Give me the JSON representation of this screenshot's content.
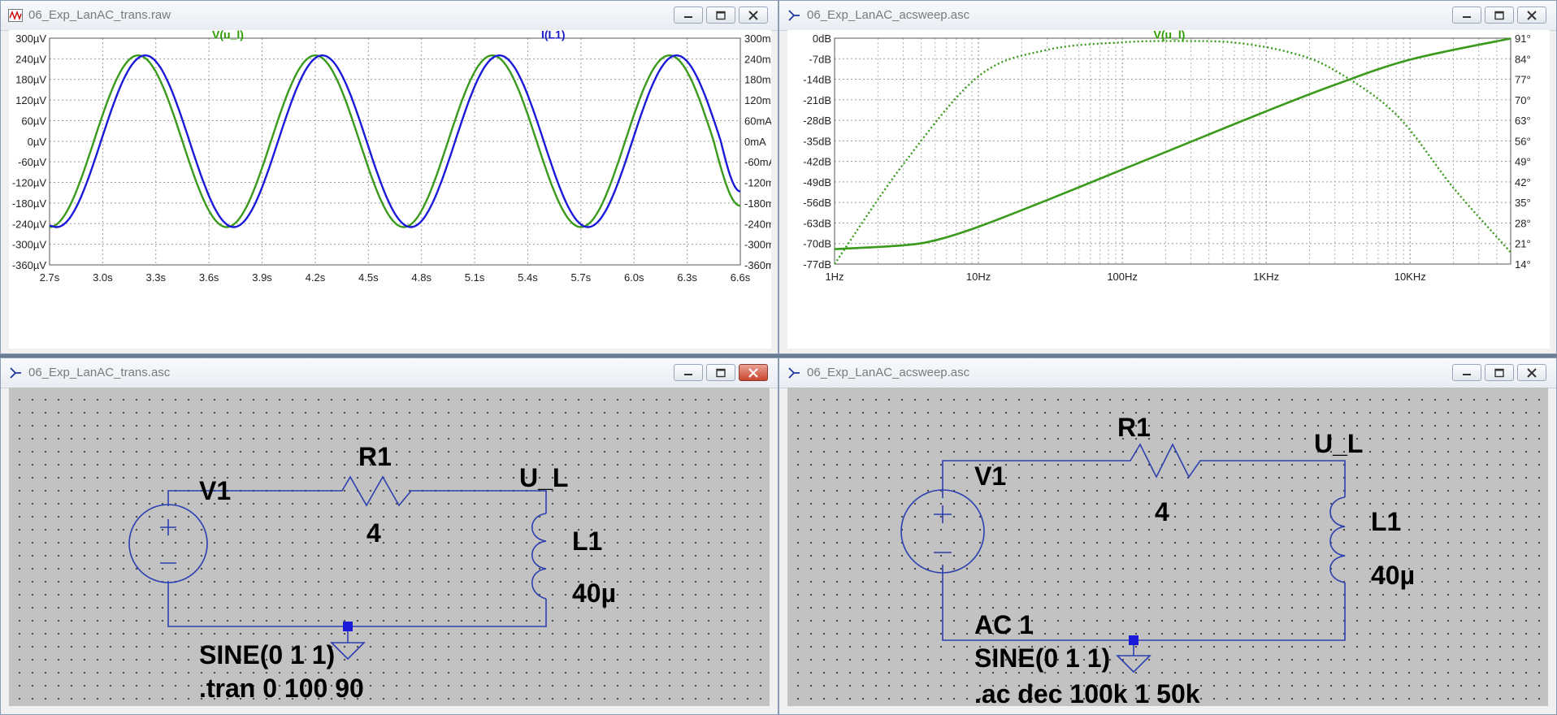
{
  "windows": {
    "trans_plot": {
      "title": "06_Exp_LanAC_trans.raw",
      "trace_left": "V(u_l)",
      "trace_right": "I(L1)",
      "y_left_ticks": [
        "300µV",
        "240µV",
        "180µV",
        "120µV",
        "60µV",
        "0µV",
        "-60µV",
        "-120µV",
        "-180µV",
        "-240µV",
        "-300µV",
        "-360µV"
      ],
      "y_right_ticks": [
        "300mA",
        "240mA",
        "180mA",
        "120mA",
        "60mA",
        "0mA",
        "-60mA",
        "-120mA",
        "-180mA",
        "-240mA",
        "-300mA",
        "-360mA"
      ],
      "x_ticks": [
        "2.7s",
        "3.0s",
        "3.3s",
        "3.6s",
        "3.9s",
        "4.2s",
        "4.5s",
        "4.8s",
        "5.1s",
        "5.4s",
        "5.7s",
        "6.0s",
        "6.3s",
        "6.6s"
      ]
    },
    "ac_plot": {
      "title": "06_Exp_LanAC_acsweep.asc",
      "trace": "V(u_l)",
      "y_left_ticks": [
        "0dB",
        "-7dB",
        "-14dB",
        "-21dB",
        "-28dB",
        "-35dB",
        "-42dB",
        "-49dB",
        "-56dB",
        "-63dB",
        "-70dB",
        "-77dB"
      ],
      "y_right_ticks": [
        "91°",
        "84°",
        "77°",
        "70°",
        "63°",
        "56°",
        "49°",
        "42°",
        "35°",
        "28°",
        "21°",
        "14°"
      ],
      "x_ticks": [
        "1Hz",
        "10Hz",
        "100Hz",
        "1KHz",
        "10KHz"
      ]
    },
    "trans_schem": {
      "title": "06_Exp_LanAC_trans.asc",
      "v_label": "V1",
      "r_label": "R1",
      "r_value": "4",
      "node_label": "U_L",
      "l_label": "L1",
      "l_value": "40µ",
      "source_value": "SINE(0 1 1)",
      "directive": ".tran 0 100 90"
    },
    "ac_schem": {
      "title": "06_Exp_LanAC_acsweep.asc",
      "v_label": "V1",
      "r_label": "R1",
      "r_value": "4",
      "node_label": "U_L",
      "l_label": "L1",
      "l_value": "40µ",
      "source_ac": "AC 1",
      "source_value": "SINE(0 1 1)",
      "directive": ".ac dec 100k 1 50k"
    }
  },
  "colors": {
    "green_trace": "#3a9a1c",
    "blue_trace": "#1a1ad8",
    "wire": "#2b3fb0",
    "label_green": "#2e9c00",
    "label_blue": "#1a1acd"
  },
  "chart_data": [
    {
      "type": "line",
      "xlim": [
        2.7,
        6.6
      ],
      "ylim_left": [
        -360,
        300
      ],
      "ylim_right": [
        -360,
        300
      ],
      "grid": true,
      "series": [
        {
          "name": "V(u_l)",
          "axis": "left",
          "x": [
            2.7,
            2.95,
            3.2,
            3.45,
            3.7,
            3.95,
            4.2,
            4.45,
            4.7,
            4.95,
            5.2,
            5.45,
            5.7,
            5.95,
            6.2,
            6.45,
            6.6
          ],
          "y": [
            -250,
            0,
            250,
            0,
            -250,
            0,
            250,
            0,
            -250,
            0,
            250,
            0,
            -250,
            0,
            250,
            0,
            -188
          ]
        },
        {
          "name": "I(L1)",
          "axis": "right",
          "x": [
            2.7,
            2.74,
            2.99,
            3.24,
            3.49,
            3.74,
            3.99,
            4.24,
            4.49,
            4.74,
            4.99,
            5.24,
            5.49,
            5.74,
            5.99,
            6.24,
            6.49,
            6.6
          ],
          "y": [
            -246,
            -250,
            0,
            250,
            0,
            -250,
            0,
            250,
            0,
            -250,
            0,
            250,
            0,
            -250,
            0,
            250,
            0,
            -146
          ]
        }
      ]
    },
    {
      "type": "line",
      "x_scale": "log",
      "xlim": [
        1,
        50000
      ],
      "ylim_left_db": [
        -77,
        0
      ],
      "ylim_right_deg": [
        14,
        91
      ],
      "grid": true,
      "series": [
        {
          "name": "magnitude",
          "style": "solid",
          "x": [
            1,
            3,
            5,
            10,
            30,
            100,
            300,
            1000,
            3000,
            10000,
            50000
          ],
          "y": [
            -71.9,
            -70.6,
            -68.9,
            -64.3,
            -55.2,
            -44.8,
            -35.3,
            -24.9,
            -15.9,
            -7.3,
            -0.1
          ]
        },
        {
          "name": "phase",
          "style": "dotted",
          "x": [
            1,
            3,
            10,
            30,
            100,
            250,
            600,
            1500,
            3000,
            8000,
            20000,
            50000
          ],
          "y": [
            14,
            48,
            78,
            87,
            89.6,
            90,
            89.5,
            86,
            80,
            65,
            40,
            18
          ]
        }
      ]
    }
  ]
}
